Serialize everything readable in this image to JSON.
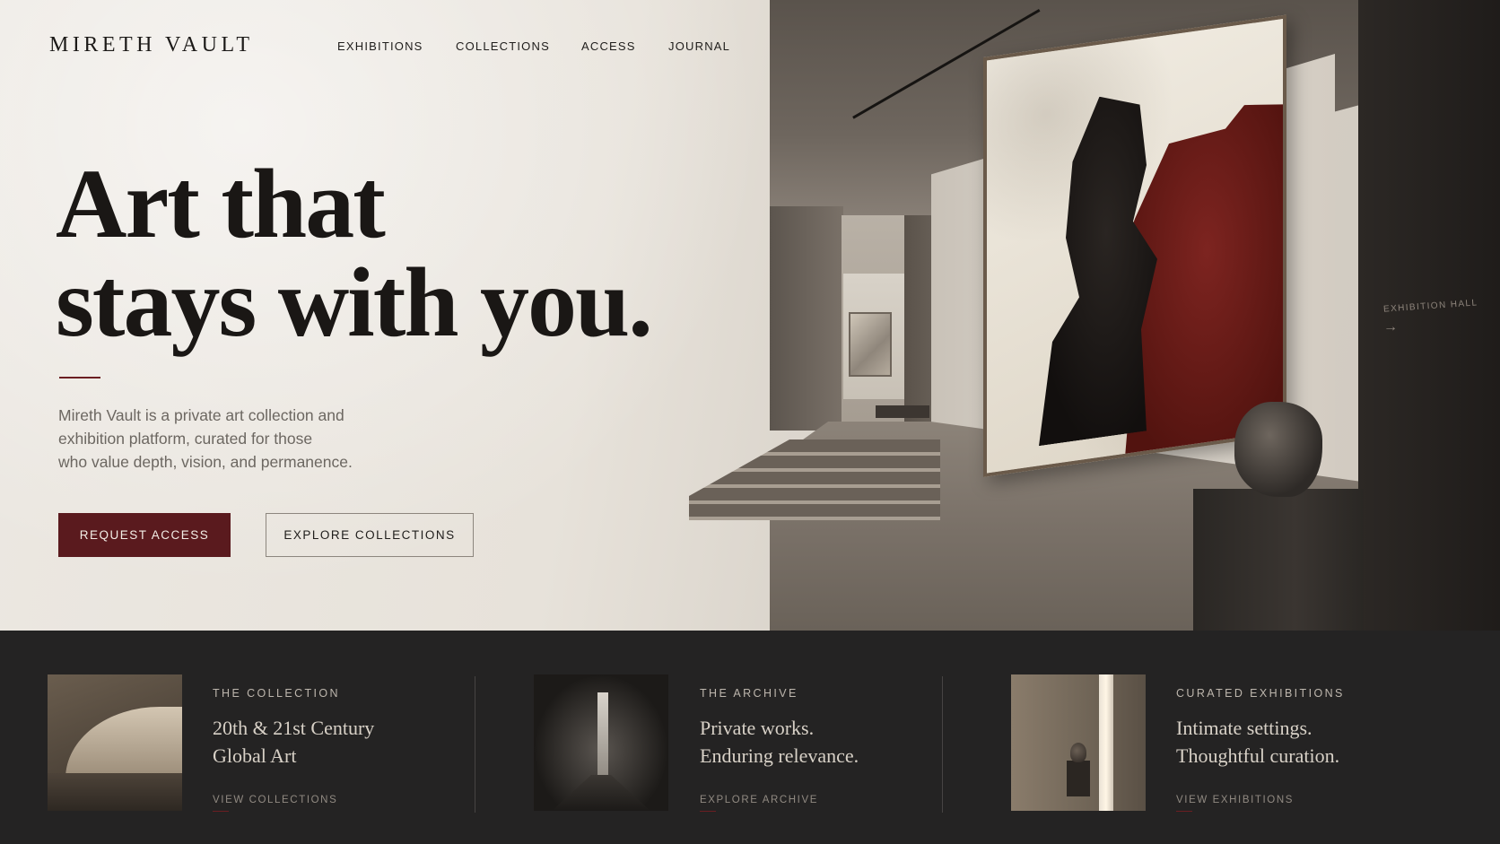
{
  "brand": {
    "logo": "MIRETH VAULT"
  },
  "nav": {
    "items": [
      {
        "label": "EXHIBITIONS"
      },
      {
        "label": "COLLECTIONS"
      },
      {
        "label": "ACCESS"
      },
      {
        "label": "JOURNAL"
      }
    ]
  },
  "hero": {
    "headline_line1": "Art that",
    "headline_line2": "stays with you.",
    "intro_line1": "Mireth Vault is a private art collection and",
    "intro_line2": "exhibition platform, curated for those",
    "intro_line3": "who value depth, vision, and permanence.",
    "primary_cta": "REQUEST ACCESS",
    "secondary_cta": "EXPLORE COLLECTIONS",
    "side_label": "EXHIBITION HALL",
    "side_arrow": "→"
  },
  "cards": [
    {
      "eyebrow": "THE COLLECTION",
      "title_line1": "20th & 21st Century",
      "title_line2": "Global Art",
      "link": "VIEW COLLECTIONS"
    },
    {
      "eyebrow": "THE ARCHIVE",
      "title_line1": "Private works.",
      "title_line2": "Enduring relevance.",
      "link": "EXPLORE ARCHIVE"
    },
    {
      "eyebrow": "CURATED EXHIBITIONS",
      "title_line1": "Intimate settings.",
      "title_line2": "Thoughtful curation.",
      "link": "VIEW EXHIBITIONS"
    }
  ],
  "colors": {
    "accent": "#5a1a1e",
    "hero_bg": "#e7e2da",
    "strip_bg": "#242323"
  }
}
